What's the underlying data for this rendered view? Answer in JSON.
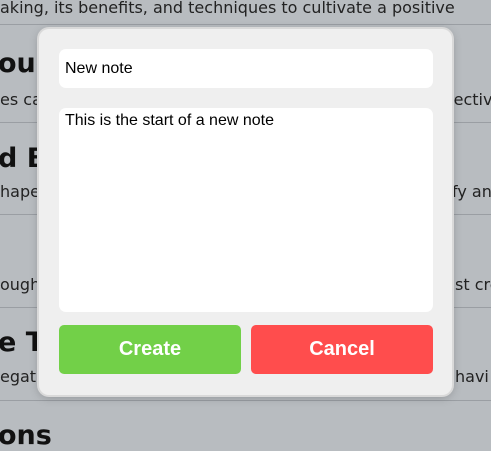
{
  "background": {
    "lines": [
      {
        "kind": "desc",
        "text": "aking, its benefits, and techniques to cultivate a positive"
      },
      {
        "kind": "title",
        "text": "oug"
      },
      {
        "kind": "desc",
        "text": "es ca"
      },
      {
        "kind": "desc",
        "text": "fectiv"
      },
      {
        "kind": "title",
        "text": "d B"
      },
      {
        "kind": "desc",
        "text": "hape"
      },
      {
        "kind": "desc",
        "text": "fy an"
      },
      {
        "kind": "desc",
        "text": "ough"
      },
      {
        "kind": "desc",
        "text": "st cre"
      },
      {
        "kind": "title",
        "text": "e T"
      },
      {
        "kind": "desc",
        "text": "egati"
      },
      {
        "kind": "desc",
        "text": "havi"
      },
      {
        "kind": "title",
        "text": "ons"
      }
    ]
  },
  "modal": {
    "title_value": "New note",
    "body_value": "This is the start of a new note",
    "create_label": "Create",
    "cancel_label": "Cancel"
  },
  "colors": {
    "create": "#72d048",
    "cancel": "#ff4d4d",
    "overlay_bg": "#b8bcc0"
  }
}
